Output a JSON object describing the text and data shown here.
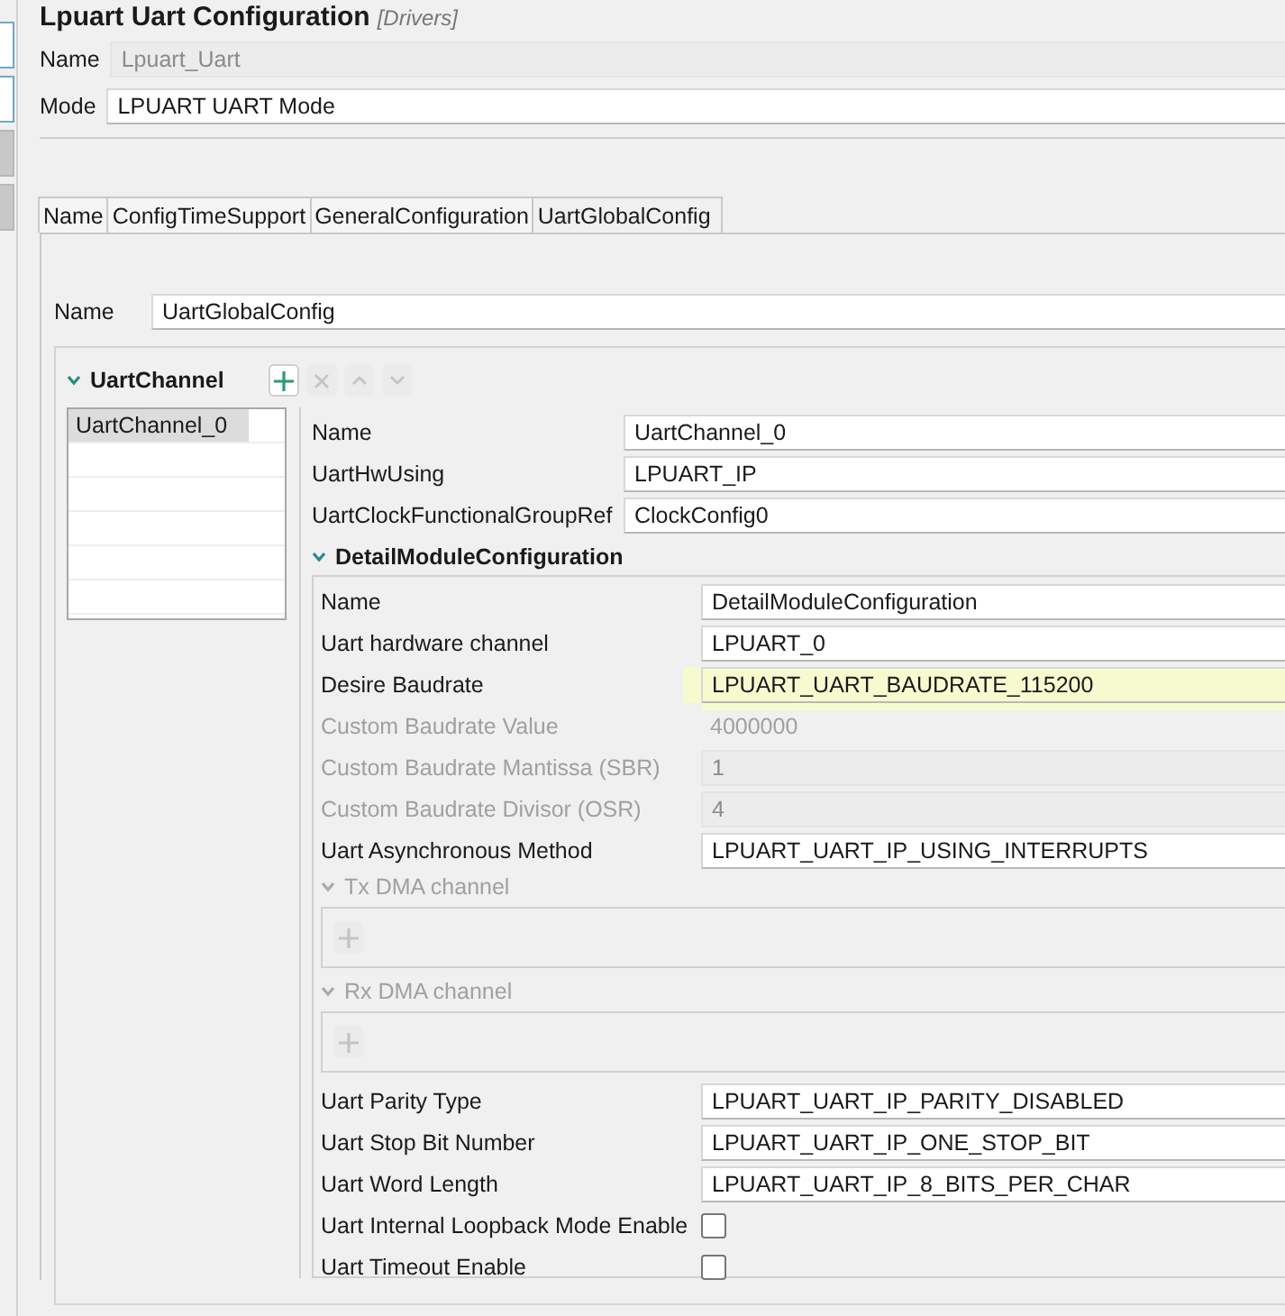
{
  "title": {
    "text": "Lpuart Uart Configuration",
    "tag": "[Drivers]"
  },
  "name": {
    "label": "Name",
    "value": "Lpuart_Uart",
    "disabled": true
  },
  "mode": {
    "label": "Mode",
    "value": "LPUART UART Mode"
  },
  "tabs": [
    {
      "label": "Name",
      "selected": false
    },
    {
      "label": "ConfigTimeSupport",
      "selected": false
    },
    {
      "label": "GeneralConfiguration",
      "selected": false
    },
    {
      "label": "UartGlobalConfig",
      "selected": true
    }
  ],
  "panel_name": {
    "label": "Name",
    "value": "UartGlobalConfig"
  },
  "channel_group": {
    "title": "UartChannel",
    "expanded": true,
    "toolbar": [
      {
        "kind": "add",
        "disabled": false
      },
      {
        "kind": "remove",
        "disabled": true
      },
      {
        "kind": "up",
        "disabled": true
      },
      {
        "kind": "down",
        "disabled": true
      }
    ],
    "items": [
      {
        "label": "UartChannel_0",
        "selected": true
      }
    ],
    "fields": [
      {
        "label": "Name",
        "value": "UartChannel_0"
      },
      {
        "label": "UartHwUsing",
        "value": "LPUART_IP"
      },
      {
        "label": "UartClockFunctionalGroupRef",
        "value": "ClockConfig0"
      }
    ]
  },
  "detail": {
    "title": "DetailModuleConfiguration",
    "expanded": true,
    "rows": [
      {
        "kind": "field",
        "label": "Name",
        "value": "DetailModuleConfiguration",
        "disabled": false,
        "highlighted": false
      },
      {
        "kind": "field",
        "label": "Uart hardware channel",
        "value": "LPUART_0",
        "disabled": false,
        "highlighted": false
      },
      {
        "kind": "field",
        "label": "Desire Baudrate",
        "value": "LPUART_UART_BAUDRATE_115200",
        "disabled": false,
        "highlighted": true
      },
      {
        "kind": "text",
        "label": "Custom Baudrate Value",
        "value": "4000000",
        "disabled": true
      },
      {
        "kind": "field",
        "label": "Custom Baudrate Mantissa (SBR)",
        "value": "1",
        "disabled": true,
        "highlighted": false
      },
      {
        "kind": "field",
        "label": "Custom Baudrate Divisor (OSR)",
        "value": "4",
        "disabled": true,
        "highlighted": false
      },
      {
        "kind": "field",
        "label": "Uart Asynchronous Method",
        "value": "LPUART_UART_IP_USING_INTERRUPTS",
        "disabled": false,
        "highlighted": false
      },
      {
        "kind": "list",
        "label": "Tx DMA channel",
        "disabled": true,
        "expanded": true
      },
      {
        "kind": "list",
        "label": "Rx DMA channel",
        "disabled": true,
        "expanded": true
      },
      {
        "kind": "field",
        "label": "Uart Parity Type",
        "value": "LPUART_UART_IP_PARITY_DISABLED",
        "disabled": false,
        "highlighted": false
      },
      {
        "kind": "field",
        "label": "Uart Stop Bit Number",
        "value": "LPUART_UART_IP_ONE_STOP_BIT",
        "disabled": false,
        "highlighted": false
      },
      {
        "kind": "field",
        "label": "Uart Word Length",
        "value": "LPUART_UART_IP_8_BITS_PER_CHAR",
        "disabled": false,
        "highlighted": false
      },
      {
        "kind": "checkbox",
        "label": "Uart Internal Loopback Mode Enable",
        "checked": false
      },
      {
        "kind": "checkbox",
        "label": "Uart Timeout Enable",
        "checked": false
      }
    ]
  }
}
